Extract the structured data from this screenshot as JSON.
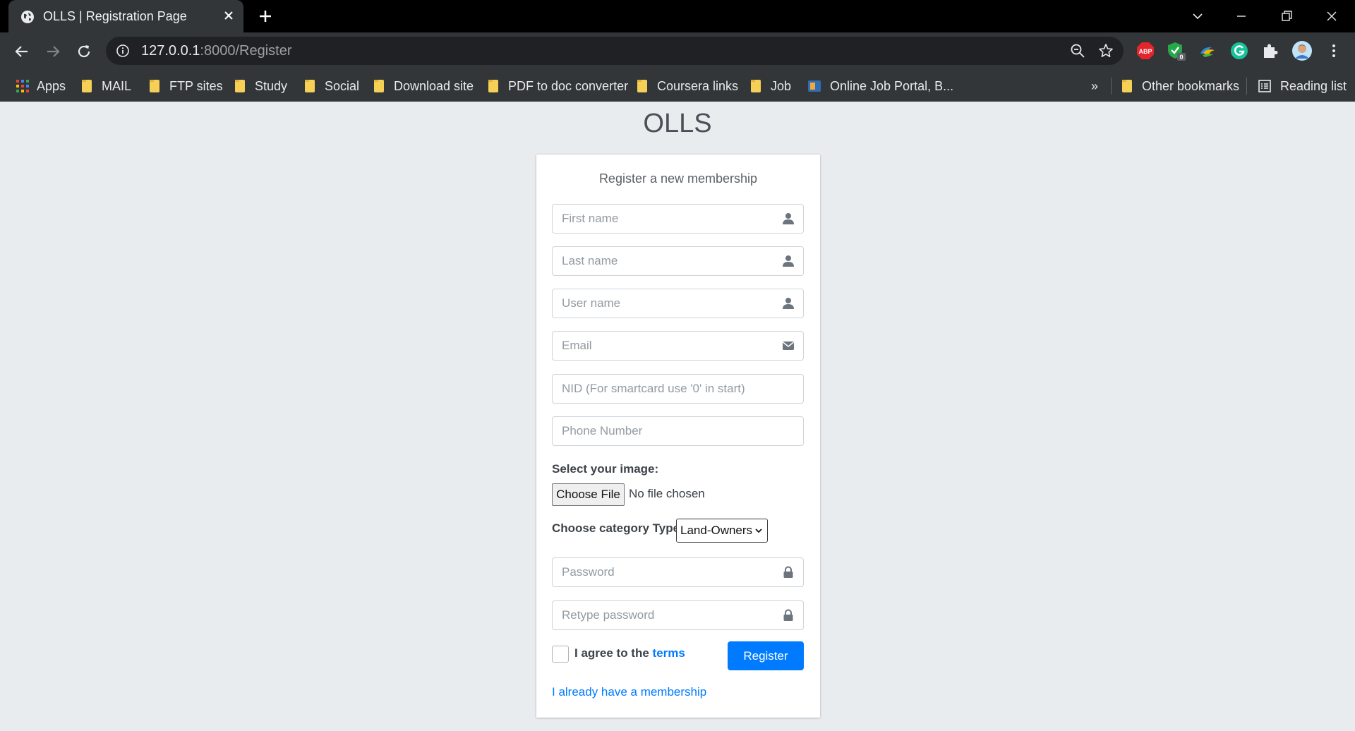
{
  "browser": {
    "tab_title": "OLLS | Registration Page",
    "url_host": "127.0.0.1",
    "url_path": ":8000/Register",
    "extensions": [
      {
        "name": "adblock-plus-icon",
        "label": "ABP"
      },
      {
        "name": "shield-extension-icon",
        "badge": "0"
      },
      {
        "name": "color-extension-icon"
      },
      {
        "name": "grammarly-icon"
      },
      {
        "name": "puzzle-icon"
      },
      {
        "name": "avatar-icon"
      }
    ],
    "bookmarks": [
      {
        "label": "Apps",
        "icon": "apps-grid-icon"
      },
      {
        "label": "MAIL",
        "icon": "folder-icon"
      },
      {
        "label": "FTP sites",
        "icon": "folder-icon"
      },
      {
        "label": "Study",
        "icon": "folder-icon"
      },
      {
        "label": "Social",
        "icon": "folder-icon"
      },
      {
        "label": "Download site",
        "icon": "folder-icon"
      },
      {
        "label": "PDF to doc converter",
        "icon": "folder-icon"
      },
      {
        "label": "Coursera links",
        "icon": "folder-icon"
      },
      {
        "label": "Job",
        "icon": "folder-icon"
      },
      {
        "label": "Online Job Portal, B...",
        "icon": "site-favicon-icon"
      }
    ],
    "overflow_label": "»",
    "other_bookmarks": "Other bookmarks",
    "reading_list": "Reading list"
  },
  "page": {
    "logo": "OLLS",
    "message": "Register a new membership",
    "fields": {
      "first_name": {
        "placeholder": "First name",
        "value": "",
        "icon": "user-icon"
      },
      "last_name": {
        "placeholder": "Last name",
        "value": "",
        "icon": "user-icon"
      },
      "user_name": {
        "placeholder": "User name",
        "value": "",
        "icon": "user-icon"
      },
      "email": {
        "placeholder": "Email",
        "value": "",
        "icon": "envelope-icon"
      },
      "nid": {
        "placeholder": "NID (For smartcard use '0' in start)",
        "value": ""
      },
      "phone": {
        "placeholder": "Phone Number",
        "value": ""
      },
      "password": {
        "placeholder": "Password",
        "value": "",
        "icon": "lock-icon"
      },
      "retype_password": {
        "placeholder": "Retype password",
        "value": "",
        "icon": "lock-icon"
      }
    },
    "image_label": "Select your image:",
    "choose_file_label": "Choose File",
    "no_file_text": "No file chosen",
    "category_label": "Choose category Type:",
    "category_selected": "Land-Owners",
    "agree_prefix": "I agree to the",
    "terms_link": "terms",
    "agree_checked": false,
    "register_label": "Register",
    "membership_link": "I already have a membership"
  },
  "colors": {
    "primary": "#007bff",
    "page_bg": "#e9ecef",
    "chrome_bg": "#323639",
    "tabbar_bg": "#000000",
    "folder": "#f6cf57"
  }
}
